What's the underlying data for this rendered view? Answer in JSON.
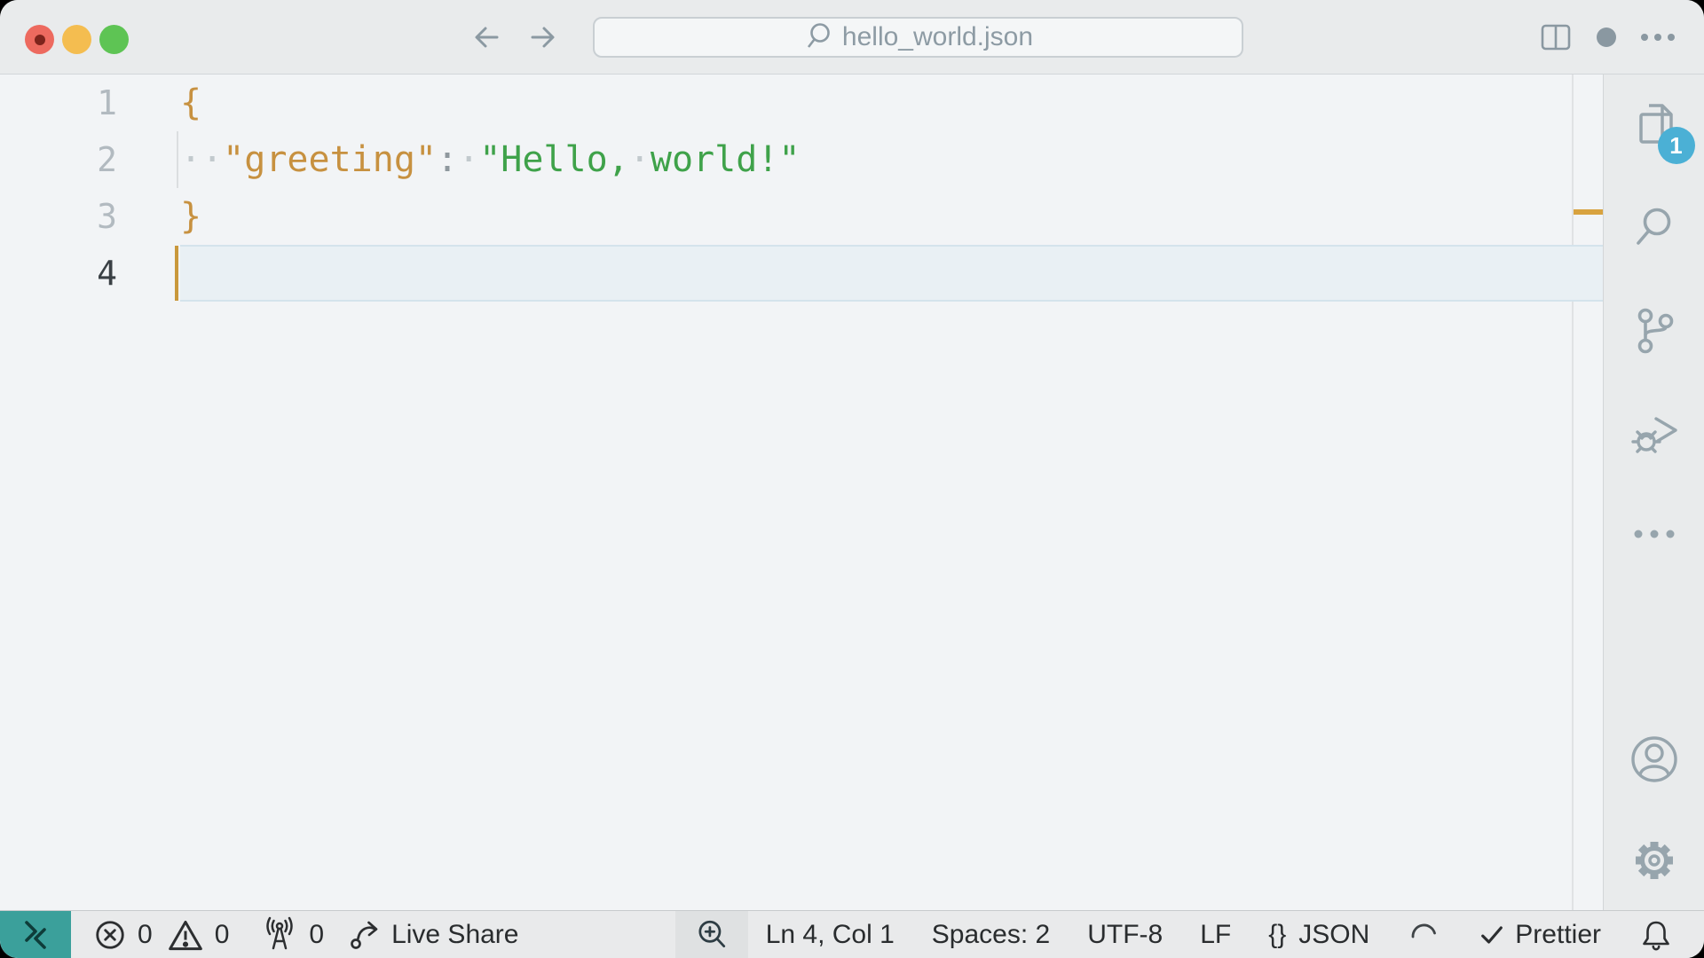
{
  "titlebar": {
    "filename": "hello_world.json"
  },
  "editor": {
    "token_colors": {
      "punct": "#c79140",
      "key": "#c79140",
      "colon": "#8f989e",
      "ws": "#c2c9cd",
      "str": "#3fa24a"
    },
    "lines": [
      {
        "num": "1",
        "active": false,
        "tokens": [
          {
            "s": "punct",
            "t": "{"
          }
        ]
      },
      {
        "num": "2",
        "active": false,
        "tokens": [
          {
            "s": "ws",
            "t": "··"
          },
          {
            "s": "key",
            "t": "\"greeting\""
          },
          {
            "s": "colon",
            "t": ":"
          },
          {
            "s": "ws",
            "t": "·"
          },
          {
            "s": "str",
            "t": "\"Hello,"
          },
          {
            "s": "ws",
            "t": "·"
          },
          {
            "s": "str",
            "t": "world!\""
          }
        ]
      },
      {
        "num": "3",
        "active": false,
        "tokens": [
          {
            "s": "punct",
            "t": "}"
          }
        ]
      },
      {
        "num": "4",
        "active": true,
        "tokens": []
      }
    ]
  },
  "activity_bar": {
    "explorer_badge": "1"
  },
  "statusbar": {
    "errors": "0",
    "warnings": "0",
    "ports": "0",
    "live_share": "Live Share",
    "cursor_position": "Ln 4, Col 1",
    "indentation": "Spaces: 2",
    "encoding": "UTF-8",
    "eol": "LF",
    "language_icon": "{}",
    "language": "JSON",
    "formatter": "Prettier"
  },
  "colors": {
    "remote_teal": "#3ba09b",
    "badge_blue": "#4bb0d5",
    "modified_orange": "#d8a23f",
    "cursor_gold": "#c9983c"
  }
}
